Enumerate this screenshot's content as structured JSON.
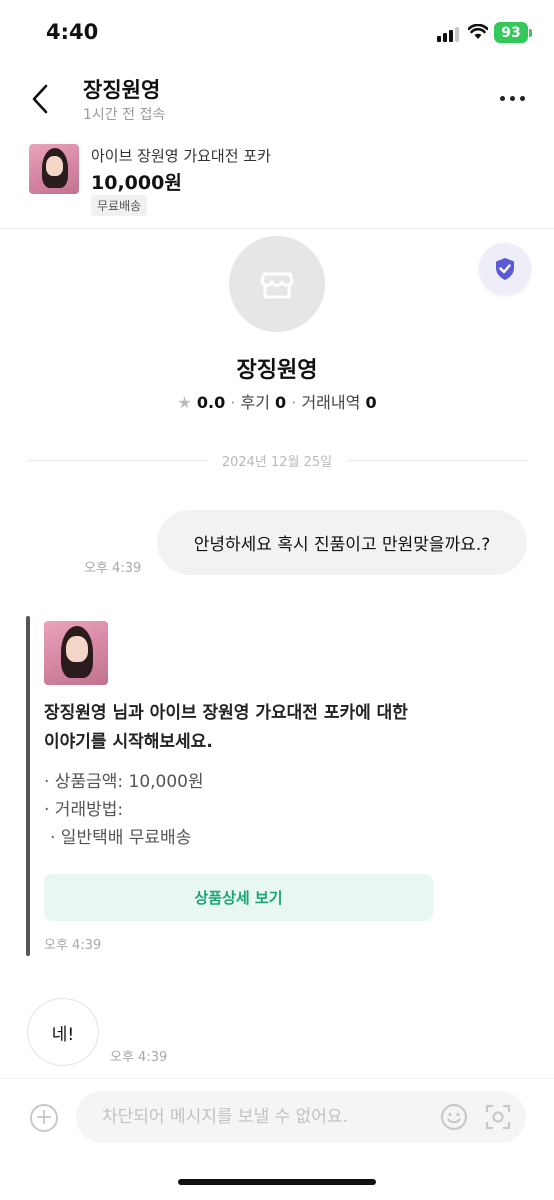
{
  "status_bar": {
    "time": "4:40",
    "battery": "93"
  },
  "header": {
    "seller_name": "장징원영",
    "last_seen": "1시간 전 접속"
  },
  "product": {
    "title": "아이브 장원영 가요대전 포카",
    "price": "10,000원",
    "shipping_badge": "무료배송"
  },
  "profile": {
    "name": "장징원영",
    "rating": "0.0",
    "reviews_label": "후기",
    "reviews_count": "0",
    "trades_label": "거래내역",
    "trades_count": "0"
  },
  "chat": {
    "date": "2024년 12월 25일",
    "my_message": "안녕하세요 혹시 진품이고 만원맞을까요.?",
    "my_message_time": "오후 4:39",
    "system_card": {
      "line1": "장징원영 님과 아이브 장원영 가요대전 포카에 대한",
      "line2": "이야기를 시작해보세요.",
      "price_item": "· 상품금액: 10,000원",
      "method_item": "· 거래방법:",
      "method_detail": " · 일반택배 무료배송",
      "detail_button": "상품상세 보기",
      "time": "오후 4:39"
    },
    "reply_message": "네!",
    "reply_time": "오후 4:39"
  },
  "input": {
    "placeholder": "차단되어 메시지를 보낼 수 없어요."
  },
  "colors": {
    "accent_green": "#1ba577",
    "battery_green": "#34c759",
    "shield_purple": "#5b5bd6"
  },
  "icons": [
    "back-arrow-icon",
    "more-icon",
    "shield-check-icon",
    "store-icon",
    "star-icon",
    "plus-icon",
    "smile-icon",
    "scan-icon"
  ]
}
